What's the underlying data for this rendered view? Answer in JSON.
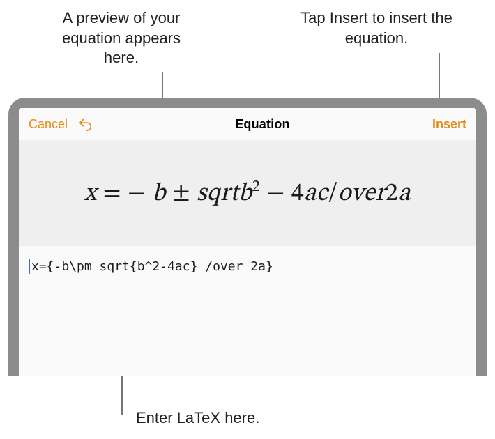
{
  "annotations": {
    "preview": "A preview of your equation appears here.",
    "insert": "Tap Insert to insert the equation.",
    "latex": "Enter LaTeX here."
  },
  "nav": {
    "cancel": "Cancel",
    "title": "Equation",
    "insert": "Insert"
  },
  "preview": {
    "equation_html": "<span>x</span> <span class='rom'>=</span> <span class='rom'>−</span> <span>b</span> <span class='rom'>±</span> <span>sqrtb</span><sup>2</sup> <span class='rom'>−</span> <span class='rom'>4</span><span>ac</span><span class='rom'>/</span><span>over</span><span class='rom'>2</span><span>a</span>"
  },
  "input": {
    "latex": "x={-b\\pm sqrt{b^2-4ac} /over 2a}"
  }
}
